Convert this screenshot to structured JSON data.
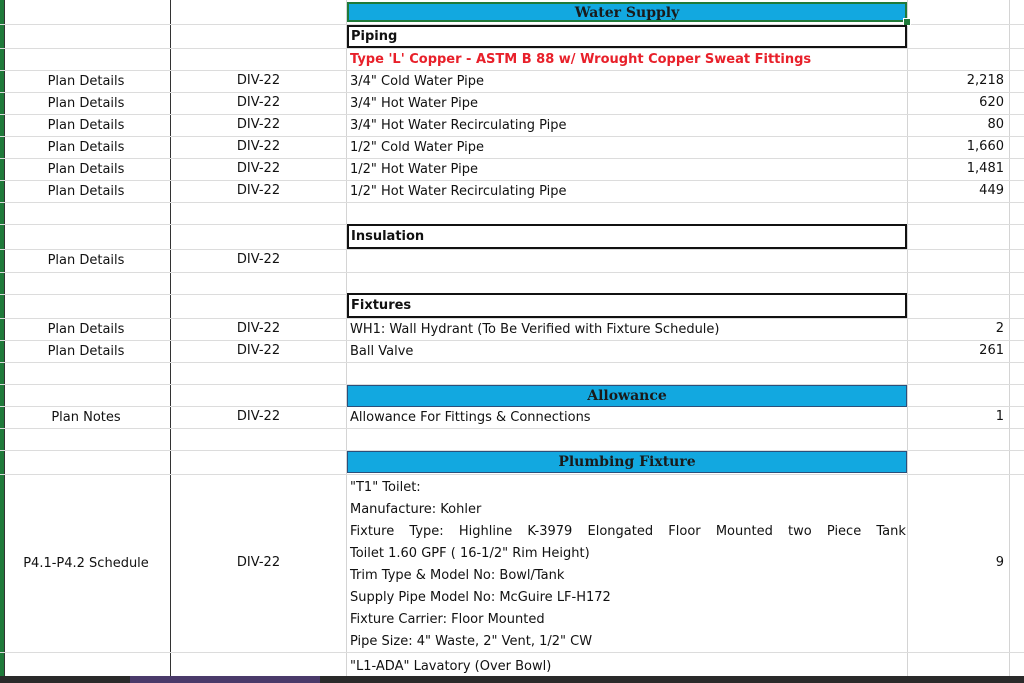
{
  "sections": {
    "water_supply": "Water Supply",
    "piping": "Piping",
    "insulation": "Insulation",
    "fixtures": "Fixtures",
    "allowance": "Allowance",
    "plumbing_fixture": "Plumbing Fixture"
  },
  "piping_spec": "Type 'L' Copper  - ASTM B 88 w/ Wrought Copper Sweat Fittings",
  "piping_rows": [
    {
      "source": "Plan Details",
      "division": "DIV-22",
      "description": "3/4\" Cold Water Pipe",
      "quantity": "2,218"
    },
    {
      "source": "Plan Details",
      "division": "DIV-22",
      "description": "3/4\" Hot Water Pipe",
      "quantity": "620"
    },
    {
      "source": "Plan Details",
      "division": "DIV-22",
      "description": "3/4\" Hot Water Recirculating Pipe",
      "quantity": "80"
    },
    {
      "source": "Plan Details",
      "division": "DIV-22",
      "description": "1/2\" Cold Water Pipe",
      "quantity": "1,660"
    },
    {
      "source": "Plan Details",
      "division": "DIV-22",
      "description": "1/2\" Hot Water Pipe",
      "quantity": "1,481"
    },
    {
      "source": "Plan Details",
      "division": "DIV-22",
      "description": "1/2\" Hot Water Recirculating Pipe",
      "quantity": "449"
    }
  ],
  "insulation_row": {
    "source": "Plan Details",
    "division": "DIV-22"
  },
  "fixture_rows": [
    {
      "source": "Plan Details",
      "division": "DIV-22",
      "description": "WH1: Wall Hydrant (To Be Verified with Fixture Schedule)",
      "quantity": "2"
    },
    {
      "source": "Plan Details",
      "division": "DIV-22",
      "description": "Ball Valve",
      "quantity": "261"
    }
  ],
  "allowance_row": {
    "source": "Plan Notes",
    "division": "DIV-22",
    "description": "Allowance For Fittings & Connections",
    "quantity": "1"
  },
  "plumbing_row": {
    "source": "P4.1-P4.2 Schedule",
    "division": "DIV-22",
    "quantity": "9",
    "lines": [
      "\"T1\" Toilet:",
      "Manufacture: Kohler",
      "Fixture Type: Highline K-3979 Elongated Floor Mounted two Piece Tank",
      "Toilet 1.60 GPF ( 16-1/2\" Rim Height)",
      "Trim Type & Model No: Bowl/Tank",
      "Supply Pipe Model No: McGuire LF-H172",
      "Fixture Carrier: Floor Mounted",
      "Pipe Size: 4\" Waste, 2\" Vent, 1/2\" CW"
    ]
  },
  "next_row_text": "\"L1-ADA\" Lavatory (Over Bowl)"
}
